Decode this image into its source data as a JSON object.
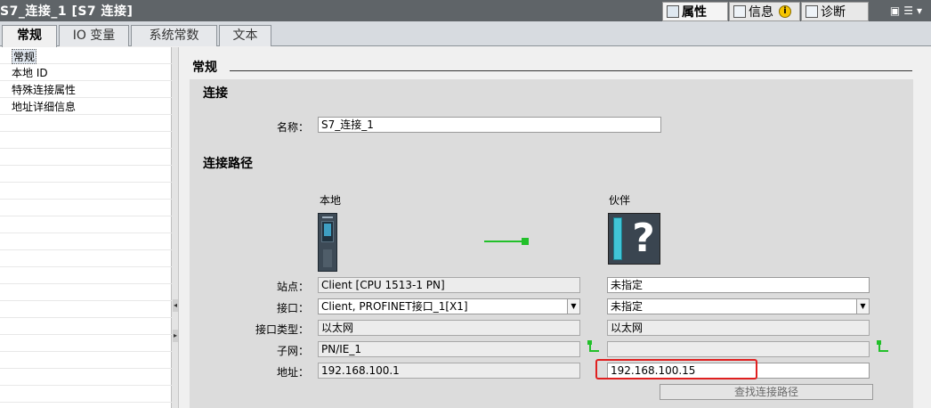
{
  "window": {
    "title": "S7_连接_1 [S7 连接]",
    "inspector_tabs": [
      {
        "label": "属性",
        "icon": "properties-icon",
        "active": true
      },
      {
        "label": "信息",
        "icon": "info-icon"
      },
      {
        "label": "诊断",
        "icon": "diagnostics-icon"
      }
    ],
    "info_badge": "i"
  },
  "tabs": [
    "常规",
    "IO 变量",
    "系统常数",
    "文本"
  ],
  "nav": {
    "items": [
      "常规",
      "本地 ID",
      "特殊连接属性",
      "地址详细信息"
    ],
    "selected": 0
  },
  "main": {
    "section_title": "常规",
    "connection_heading": "连接",
    "name_label": "名称：",
    "name_value": "S7_连接_1",
    "path_heading": "连接路径",
    "local_heading": "本地",
    "partner_heading": "伙伴",
    "rows": {
      "station": {
        "label": "站点：",
        "local": "Client [CPU 1513-1 PN]",
        "partner": "未指定"
      },
      "interface": {
        "label": "接口：",
        "local": "Client, PROFINET接口_1[X1]",
        "partner": "未指定"
      },
      "interface_type": {
        "label": "接口类型：",
        "local": "以太网",
        "partner": "以太网"
      },
      "subnet": {
        "label": "子网：",
        "local": "PN/IE_1",
        "partner": ""
      },
      "address": {
        "label": "地址：",
        "local": "192.168.100.1",
        "partner": "192.168.100.15"
      }
    },
    "find_path_button": "查找连接路径"
  },
  "colors": {
    "link_line": "#22c02a",
    "highlight": "#e02020",
    "titlebar": "#5f6468"
  }
}
